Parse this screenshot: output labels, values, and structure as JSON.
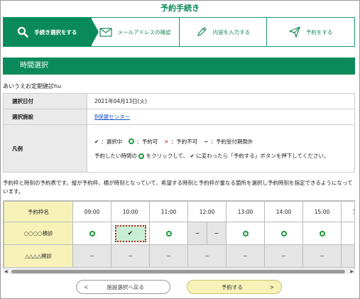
{
  "page": {
    "title": "予約手続き"
  },
  "steps": [
    {
      "label": "手続き選択をする",
      "icon": "magnifier-icon",
      "active": true
    },
    {
      "label": "メールアドレスの確認",
      "icon": "envelope-icon",
      "active": false
    },
    {
      "label": "内容を入力する",
      "icon": "pencil-icon",
      "active": false
    },
    {
      "label": "予約をする",
      "icon": "paper-plane-icon",
      "active": false
    }
  ],
  "section": {
    "title": "時間選択"
  },
  "exam_name": "あいうえお定期健診hu",
  "info": {
    "date_label": "選択日付",
    "date_value": "2021年04月13日(火)",
    "facility_label": "選択施設",
    "facility_value": "B保健センター",
    "legend_label": "凡例",
    "legend_selected": "：選択中",
    "legend_available": "：予約可",
    "legend_unavailable": "：予約不可",
    "legend_outside": "：予約受付期間外",
    "legend_note_1": "予約したい時間の",
    "legend_note_2": "をクリックして、",
    "legend_note_3": "に変わったら「予約する」ボタンを押下してください。"
  },
  "description": "予約枠と時刻の予約表です。縦が予約枠、横が時刻となっていて、希望する時刻と予約枠が重なる箇所を選択し予約時刻を指定できるようになっています。",
  "grid": {
    "corner_label": "予約枠名",
    "times": [
      "09:00",
      "10:00",
      "11:00",
      "12:00",
      "13:00",
      "14:00",
      "15:00",
      "16:00"
    ],
    "rows": [
      {
        "name": "○○○○検診",
        "cells": [
          "○",
          "✔",
          "○",
          "−|−",
          "○",
          "○",
          "○",
          "○"
        ]
      },
      {
        "name": "△△△△検診",
        "cells": [
          "−",
          "−",
          "−",
          "−",
          "−",
          "−",
          "−",
          "−"
        ]
      }
    ]
  },
  "buttons": {
    "back_label": "施設選択へ戻る",
    "back_arrow": "<",
    "reserve_label": "予約する",
    "reserve_arrow": ">"
  },
  "scroll": {
    "left": "◀",
    "right": "▶"
  },
  "colors": {
    "brand_green": "#0a8a5a",
    "available_green": "#1a9a3a",
    "unavailable_red": "#dd2222",
    "slot_header_yellow": "#f7f3b8",
    "selected_fill": "#c8eed6"
  }
}
